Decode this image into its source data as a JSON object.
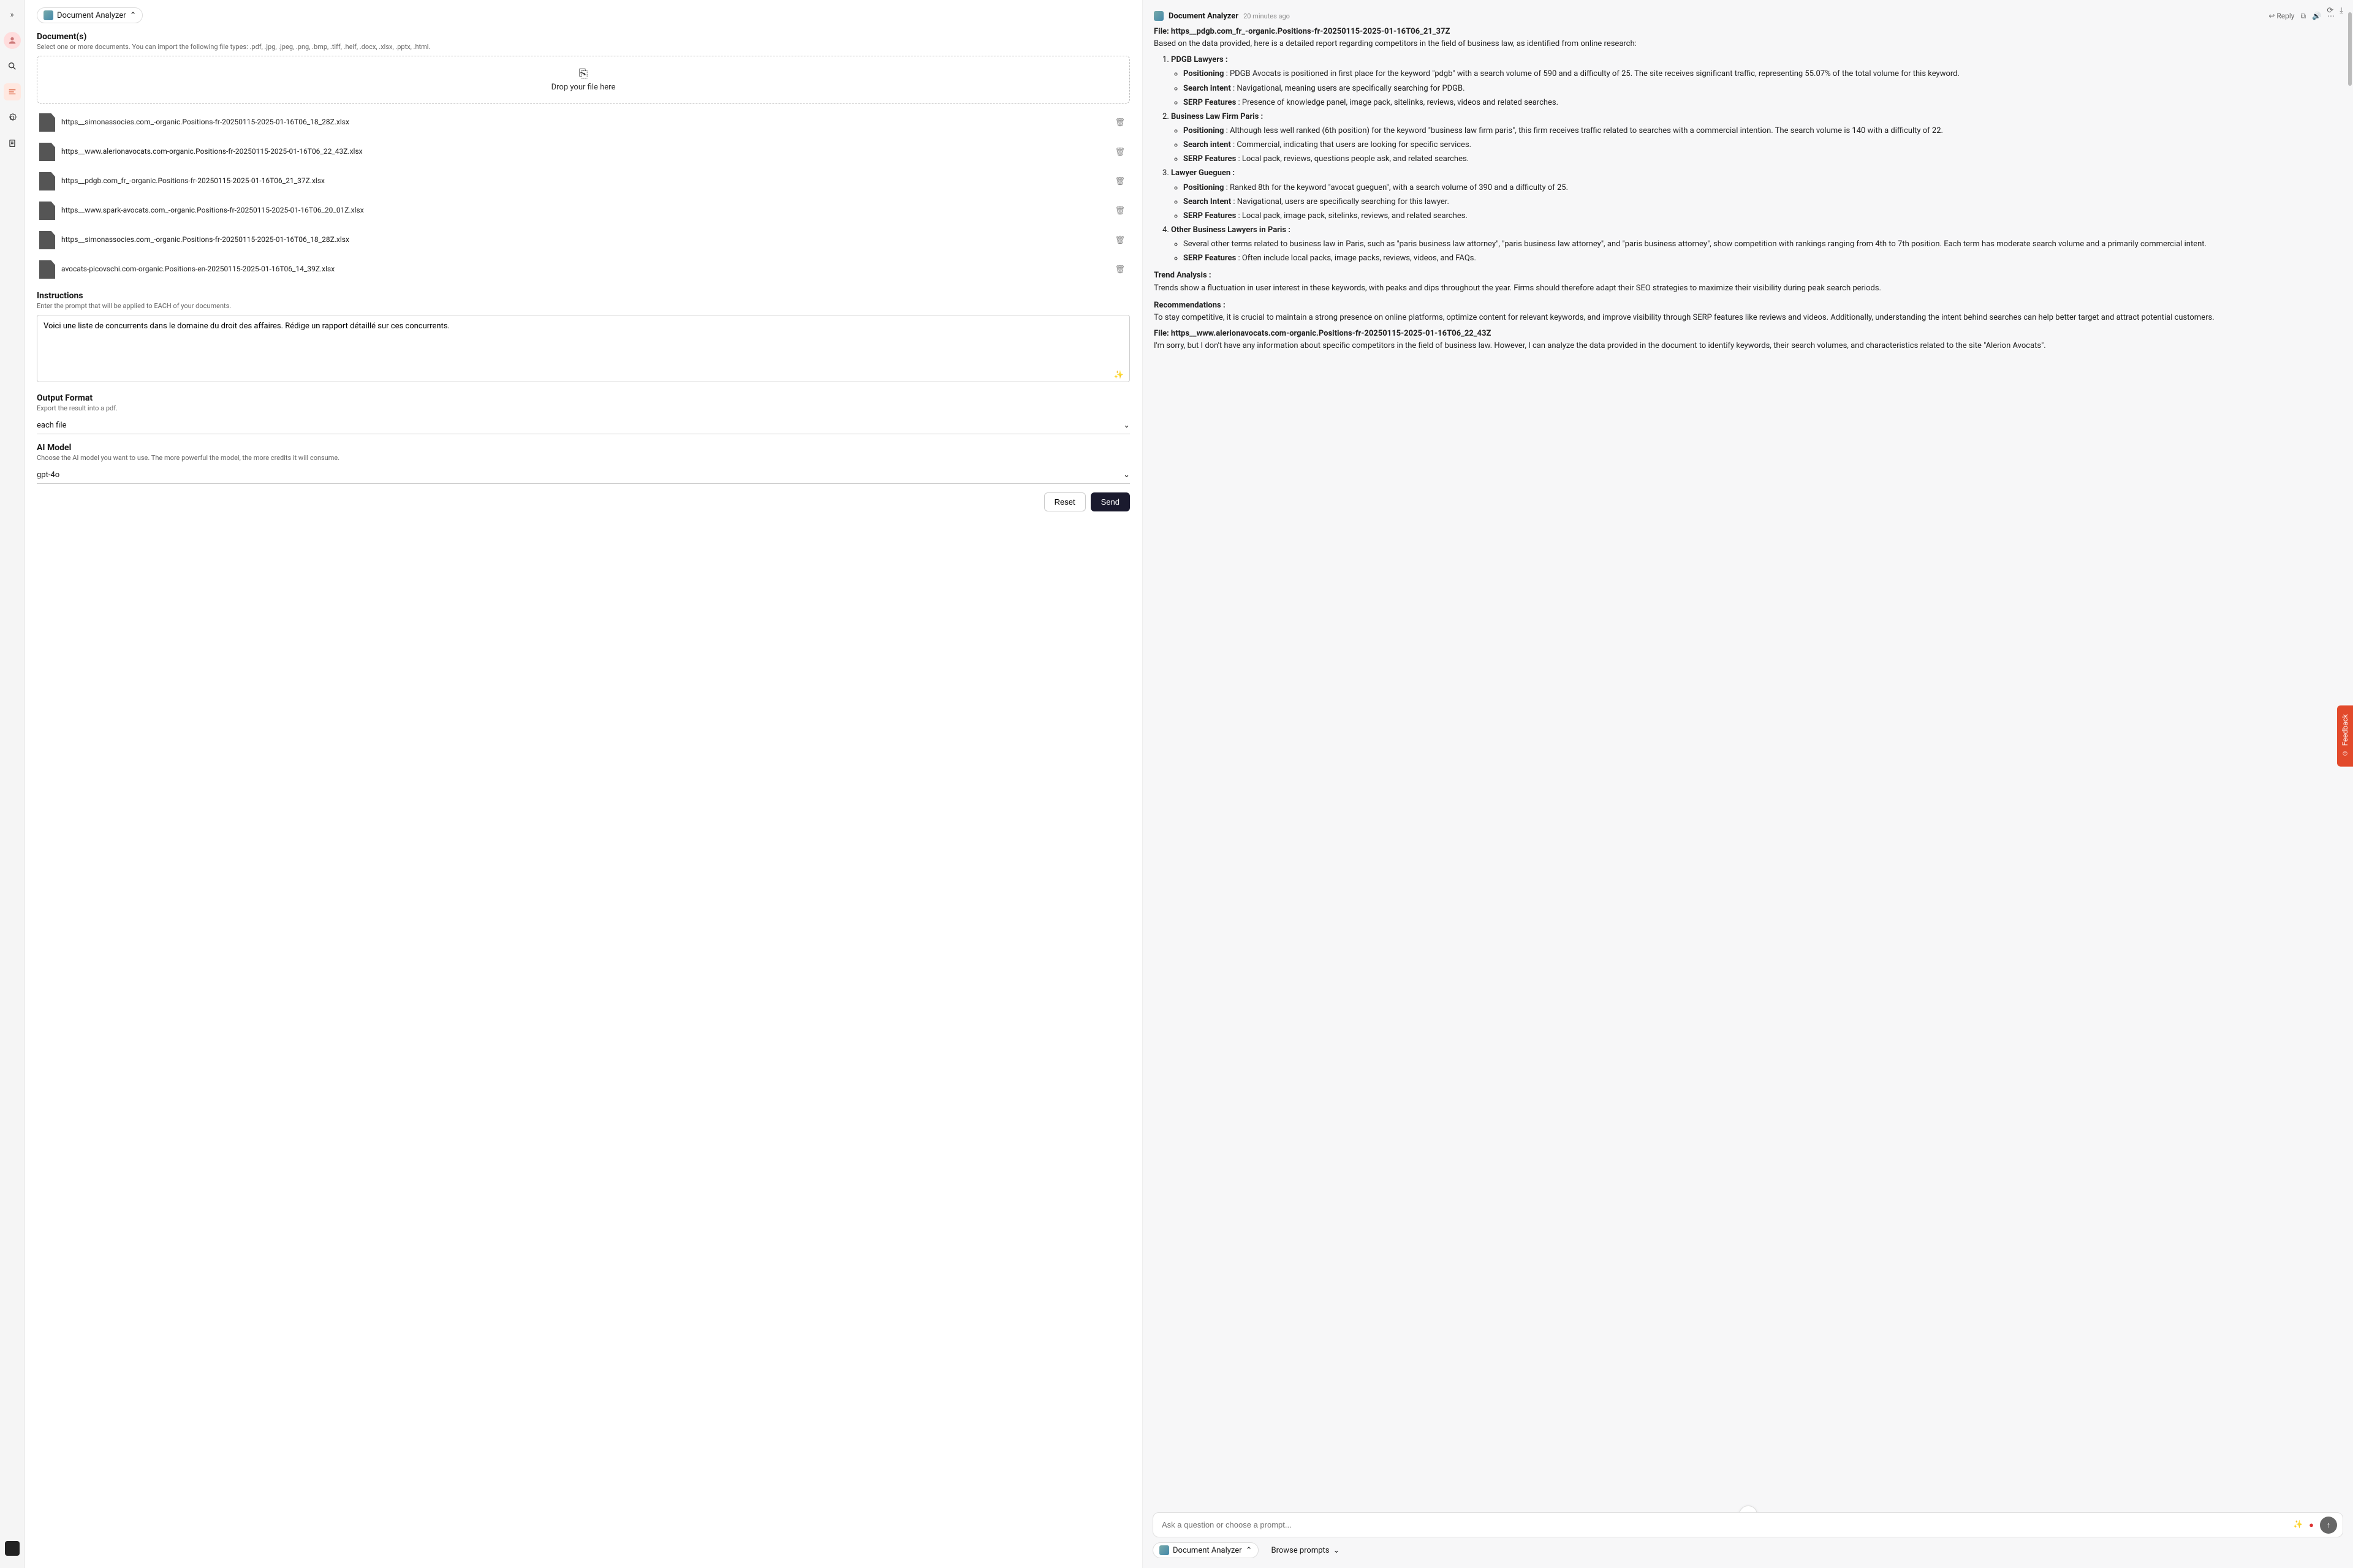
{
  "app": {
    "title": "Document Analyzer"
  },
  "rail": {
    "items": [
      "expand-icon",
      "avatar",
      "search-icon",
      "bars-icon",
      "settings-icon",
      "clipboard-icon"
    ]
  },
  "left": {
    "docs_title": "Document(s)",
    "docs_sub": "Select one or more documents. You can import the following file types: .pdf, .jpg, .jpeg, .png, .bmp, .tiff, .heif, .docx, .xlsx, .pptx, .html.",
    "dropzone": "Drop your file here",
    "files": [
      "https__simonassocies.com_-organic.Positions-fr-20250115-2025-01-16T06_18_28Z.xlsx",
      "https__www.alerionavocats.com-organic.Positions-fr-20250115-2025-01-16T06_22_43Z.xlsx",
      "https__pdgb.com_fr_-organic.Positions-fr-20250115-2025-01-16T06_21_37Z.xlsx",
      "https__www.spark-avocats.com_-organic.Positions-fr-20250115-2025-01-16T06_20_01Z.xlsx",
      "https__simonassocies.com_-organic.Positions-fr-20250115-2025-01-16T06_18_28Z.xlsx",
      "avocats-picovschi.com-organic.Positions-en-20250115-2025-01-16T06_14_39Z.xlsx"
    ],
    "instr_title": "Instructions",
    "instr_sub": "Enter the prompt that will be applied to EACH of your documents.",
    "instr_value": "Voici une liste de concurrents dans le domaine du droit des affaires. Rédige un rapport détaillé sur ces concurrents.",
    "outfmt_title": "Output Format",
    "outfmt_sub": "Export the result into a pdf.",
    "outfmt_value": "each file",
    "model_title": "AI Model",
    "model_sub": "Choose the AI model you want to use. The more powerful the model, the more credits it will consume.",
    "model_value": "gpt-4o",
    "reset": "Reset",
    "send": "Send"
  },
  "chat": {
    "bot_name": "Document Analyzer",
    "time": "20 minutes ago",
    "reply": "Reply",
    "file1_hdr": "File: https__pdgb.com_fr_-organic.Positions-fr-20250115-2025-01-16T06_21_37Z",
    "intro": "Based on the data provided, here is a detailed report regarding competitors in the field of business law, as identified from online research:",
    "items": [
      {
        "title": "PDGB Lawyers :",
        "bullets": [
          {
            "k": "Positioning",
            "v": " : PDGB Avocats is positioned in first place for the keyword \"pdgb\" with a search volume of 590 and a difficulty of 25. The site receives significant traffic, representing 55.07% of the total volume for this keyword."
          },
          {
            "k": "Search intent",
            "v": " : Navigational, meaning users are specifically searching for PDGB."
          },
          {
            "k": "SERP Features",
            "v": " : Presence of knowledge panel, image pack, sitelinks, reviews, videos and related searches."
          }
        ]
      },
      {
        "title": "Business Law Firm Paris :",
        "bullets": [
          {
            "k": "Positioning",
            "v": " : Although less well ranked (6th position) for the keyword \"business law firm paris\", this firm receives traffic related to searches with a commercial intention. The search volume is 140 with a difficulty of 22."
          },
          {
            "k": "Search intent",
            "v": " : Commercial, indicating that users are looking for specific services."
          },
          {
            "k": "SERP Features",
            "v": " : Local pack, reviews, questions people ask, and related searches."
          }
        ]
      },
      {
        "title": "Lawyer Gueguen :",
        "bullets": [
          {
            "k": "Positioning",
            "v": " : Ranked 8th for the keyword \"avocat gueguen\", with a search volume of 390 and a difficulty of 25."
          },
          {
            "k": "Search Intent",
            "v": " : Navigational, users are specifically searching for this lawyer."
          },
          {
            "k": "SERP Features",
            "v": " : Local pack, image pack, sitelinks, reviews, and related searches."
          }
        ]
      },
      {
        "title": "Other Business Lawyers in Paris :",
        "bullets": [
          {
            "k": "",
            "v": "Several other terms related to business law in Paris, such as \"paris business law attorney\", \"paris business law attorney\", and \"paris business attorney\", show competition with rankings ranging from 4th to 7th position. Each term has moderate search volume and a primarily commercial intent."
          },
          {
            "k": "SERP Features",
            "v": " : Often include local packs, image packs, reviews, videos, and FAQs."
          }
        ]
      }
    ],
    "trend_hdr": "Trend Analysis :",
    "trend_body": "Trends show a fluctuation in user interest in these keywords, with peaks and dips throughout the year. Firms should therefore adapt their SEO strategies to maximize their visibility during peak search periods.",
    "rec_hdr": "Recommendations :",
    "rec_body": "To stay competitive, it is crucial to maintain a strong presence on online platforms, optimize content for relevant keywords, and improve visibility through SERP features like reviews and videos. Additionally, understanding the intent behind searches can help better target and attract potential customers.",
    "file2_hdr": "File: https__www.alerionavocats.com-organic.Positions-fr-20250115-2025-01-16T06_22_43Z",
    "file2_body": "I'm sorry, but I don't have any information about specific competitors in the field of business law. However, I can analyze the data provided in the document to identify keywords, their search volumes, and characteristics related to the site \"Alerion Avocats\"."
  },
  "composer": {
    "placeholder": "Ask a question or choose a prompt...",
    "chip1": "Document Analyzer",
    "chip2": "Browse prompts"
  },
  "feedback": "Feedback"
}
